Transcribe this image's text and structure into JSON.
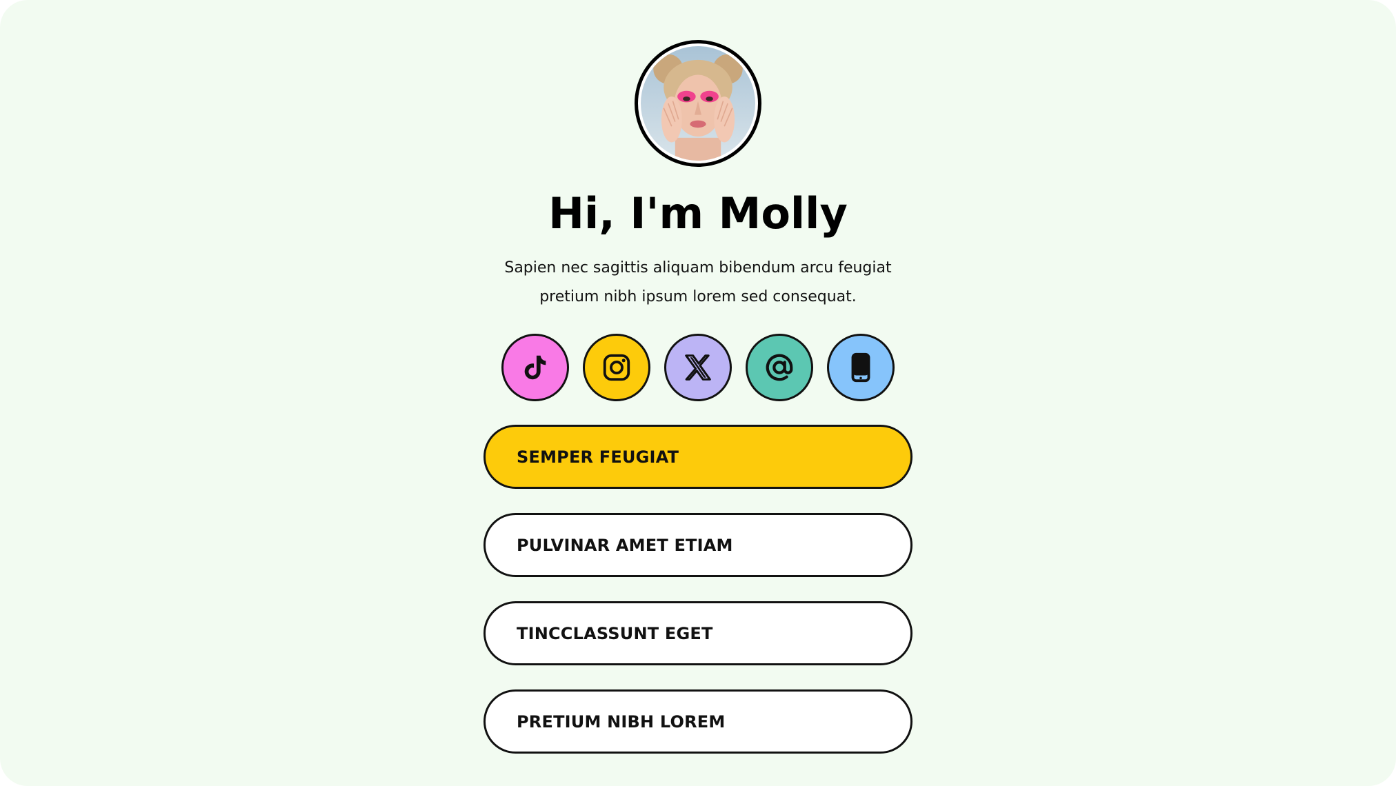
{
  "profile": {
    "avatar_alt": "Profile photo",
    "title": "Hi, I'm Molly",
    "bio": "Sapien nec sagittis aliquam bibendum arcu feugiat pretium nibh ipsum lorem sed consequat."
  },
  "socials": [
    {
      "icon": "tiktok-icon",
      "color": "#f97ae6"
    },
    {
      "icon": "instagram-icon",
      "color": "#fdcb0b"
    },
    {
      "icon": "x-icon",
      "color": "#bcb4f5"
    },
    {
      "icon": "at-sign-icon",
      "color": "#5cc7b2"
    },
    {
      "icon": "phone-icon",
      "color": "#86c4fb"
    }
  ],
  "links": [
    {
      "label": "SEMPER FEUGIAT",
      "color": "#fdcb0b"
    },
    {
      "label": "PULVINAR AMET ETIAM",
      "color": "#ffffff"
    },
    {
      "label": "TINCCLASSUNT EGET",
      "color": "#ffffff"
    },
    {
      "label": "PRETIUM NIBH LOREM",
      "color": "#ffffff"
    }
  ],
  "colors": {
    "background": "#f2fbf1",
    "border": "#111111",
    "accent": "#fdcb0b"
  }
}
